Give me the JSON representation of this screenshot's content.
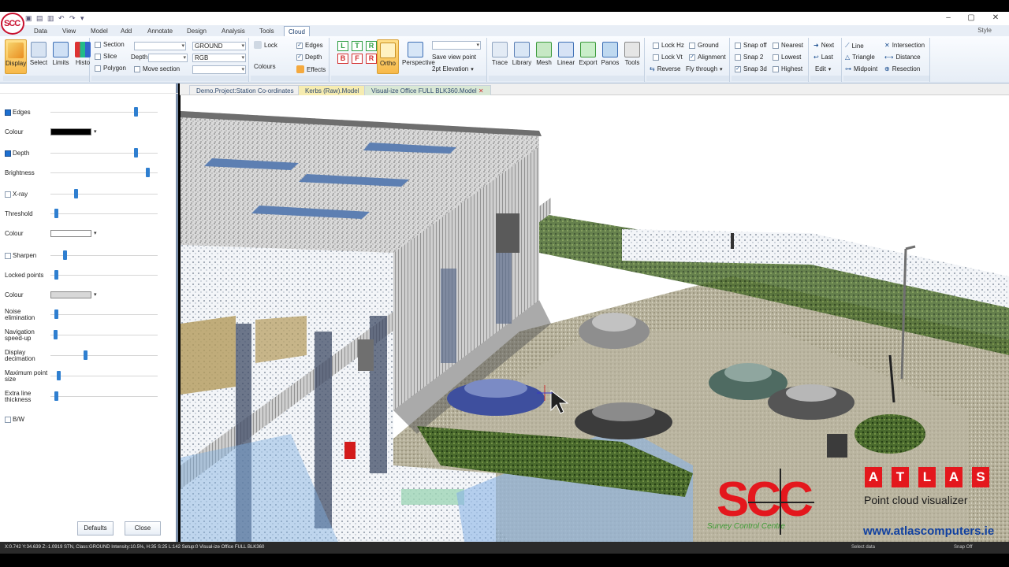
{
  "app": {
    "logo_text": "SCC",
    "style_label": "Style"
  },
  "quick_access": [
    "▣",
    "▤",
    "▥",
    "↶",
    "↷",
    "▾"
  ],
  "window_controls": {
    "minimize": "–",
    "maximize": "▢",
    "close": "✕"
  },
  "ribbon_tabs": [
    {
      "label": "Data",
      "active": false
    },
    {
      "label": "View",
      "active": false
    },
    {
      "label": "Model",
      "active": false
    },
    {
      "label": "Add",
      "active": false
    },
    {
      "label": "Annotate",
      "active": false
    },
    {
      "label": "Design",
      "active": false
    },
    {
      "label": "Analysis",
      "active": false
    },
    {
      "label": "Tools",
      "active": false
    },
    {
      "label": "Cloud",
      "active": true
    }
  ],
  "ribbon": {
    "display": "Display",
    "select": "Select",
    "limits": "Limits",
    "histo": "Histo",
    "section": "Section",
    "slice": "Slice",
    "polygon": "Polygon",
    "depth_label": "Depth",
    "move_section": "Move section",
    "ground_value": "GROUND",
    "rgb_value": "RGB",
    "lock": "Lock",
    "colours": "Colours",
    "edges": "Edges",
    "depth": "Depth",
    "effects": "Effects",
    "ortho": "Ortho",
    "perspective": "Perspective",
    "save_view_point": "Save view point",
    "elevation": "2pt Elevation",
    "view_letters": [
      "L",
      "T",
      "R",
      "B",
      "F",
      "R"
    ],
    "trace": "Trace",
    "library": "Library",
    "mesh": "Mesh",
    "linear": "Linear",
    "export": "Export",
    "panos": "Panos",
    "tools": "Tools",
    "lock_hz": "Lock Hz",
    "ground": "Ground",
    "lock_vt": "Lock Vt",
    "alignment": "Alignment",
    "reverse": "Reverse",
    "fly_through": "Fly through",
    "snap_off": "Snap off",
    "nearest": "Nearest",
    "snap_2": "Snap 2",
    "lowest": "Lowest",
    "snap_3d": "Snap 3d",
    "highest": "Highest",
    "next": "Next",
    "last": "Last",
    "edit": "Edit",
    "line": "Line",
    "intersection": "Intersection",
    "triangle": "Triangle",
    "distance": "Distance",
    "midpoint": "Midpoint",
    "resection": "Resection"
  },
  "doc_tabs": [
    {
      "label": "Demo.Project:Station Co-ordinates",
      "style": "plain"
    },
    {
      "label": "Kerbs (Raw).Model",
      "style": "y"
    },
    {
      "label": "Visual-ize Office FULL BLK360.Model",
      "style": "g"
    }
  ],
  "panel": {
    "rows": [
      {
        "label": "Edges",
        "checkbox": true,
        "checked": true,
        "thumb": 0.78,
        "swatch": null
      },
      {
        "label": "Colour",
        "checkbox": false,
        "checked": false,
        "thumb": null,
        "swatch": "#000000"
      },
      {
        "label": "Depth",
        "checkbox": true,
        "checked": true,
        "thumb": 0.78,
        "swatch": null
      },
      {
        "label": "Brightness",
        "checkbox": false,
        "checked": false,
        "thumb": 0.89,
        "swatch": null
      },
      {
        "label": "X-ray",
        "checkbox": true,
        "checked": false,
        "thumb": 0.22,
        "swatch": null
      },
      {
        "label": "Threshold",
        "checkbox": false,
        "checked": false,
        "thumb": 0.04,
        "swatch": null
      },
      {
        "label": "Colour",
        "checkbox": false,
        "checked": false,
        "thumb": null,
        "swatch": "#ffffff"
      },
      {
        "label": "Sharpen",
        "checkbox": true,
        "checked": false,
        "thumb": 0.12,
        "swatch": null
      },
      {
        "label": "Locked points",
        "checkbox": false,
        "checked": false,
        "thumb": 0.04,
        "swatch": null
      },
      {
        "label": "Colour",
        "checkbox": false,
        "checked": false,
        "thumb": null,
        "swatch": "#d8d8d8"
      },
      {
        "label": "Noise elimination",
        "checkbox": false,
        "checked": false,
        "thumb": 0.04,
        "swatch": null
      },
      {
        "label": "Navigation speed-up",
        "checkbox": false,
        "checked": false,
        "thumb": 0.03,
        "swatch": null
      },
      {
        "label": "Display decimation",
        "checkbox": false,
        "checked": false,
        "thumb": 0.31,
        "swatch": null
      },
      {
        "label": "Maximum point size",
        "checkbox": false,
        "checked": false,
        "thumb": 0.06,
        "swatch": null
      },
      {
        "label": "Extra line thickness",
        "checkbox": false,
        "checked": false,
        "thumb": 0.04,
        "swatch": null
      },
      {
        "label": "B/W",
        "checkbox": true,
        "checked": false,
        "thumb": null,
        "swatch": null
      }
    ],
    "defaults": "Defaults",
    "close": "Close"
  },
  "watermark": {
    "scc_text": "SCC",
    "scc_sub": "Survey Control Centre",
    "atlas_letters": [
      "A",
      "T",
      "L",
      "A",
      "S"
    ],
    "tagline": "Point cloud visualizer",
    "url": "www.atlascomputers.ie"
  },
  "status": {
    "text": "X:0.742 Y:34.639 Z:-1.0919 STN, Class:GROUND Intensity:10.5%, H:35 S:25 L:142 Setup:0 Visual-ize Office FULL BLK360",
    "right1": "Select data",
    "right2": "Snap Off"
  },
  "colors": {
    "accent_red": "#e4171d",
    "tab_blue": "#1a3d6d",
    "slider_blue": "#2f7fd0"
  }
}
